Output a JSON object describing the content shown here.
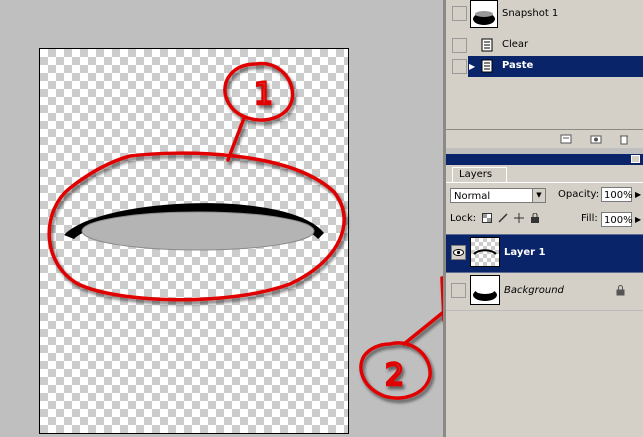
{
  "history": {
    "items": [
      {
        "label": "Snapshot 1",
        "icon": "snapshot-icon",
        "selected": false
      },
      {
        "label": "Clear",
        "icon": "history-state-icon",
        "selected": false
      },
      {
        "label": "Paste",
        "icon": "history-state-icon",
        "selected": true
      }
    ]
  },
  "layers": {
    "tab_label": "Layers",
    "blend_mode": "Normal",
    "opacity_label": "Opacity:",
    "opacity_value": "100%",
    "lock_label": "Lock:",
    "fill_label": "Fill:",
    "fill_value": "100%",
    "items": [
      {
        "name": "Layer 1",
        "selected": true,
        "visible": true
      },
      {
        "name": "Background",
        "selected": false,
        "visible": false,
        "locked": true
      }
    ]
  },
  "annotations": [
    {
      "number": "1",
      "color": "#e00000"
    },
    {
      "number": "2",
      "color": "#e00000"
    }
  ],
  "colors": {
    "selection": "#0a246a",
    "panel": "#d4d0c8",
    "workspace": "#bfbfbf",
    "annotation": "#e00000",
    "ellipse_fill": "#b4b4b4"
  }
}
